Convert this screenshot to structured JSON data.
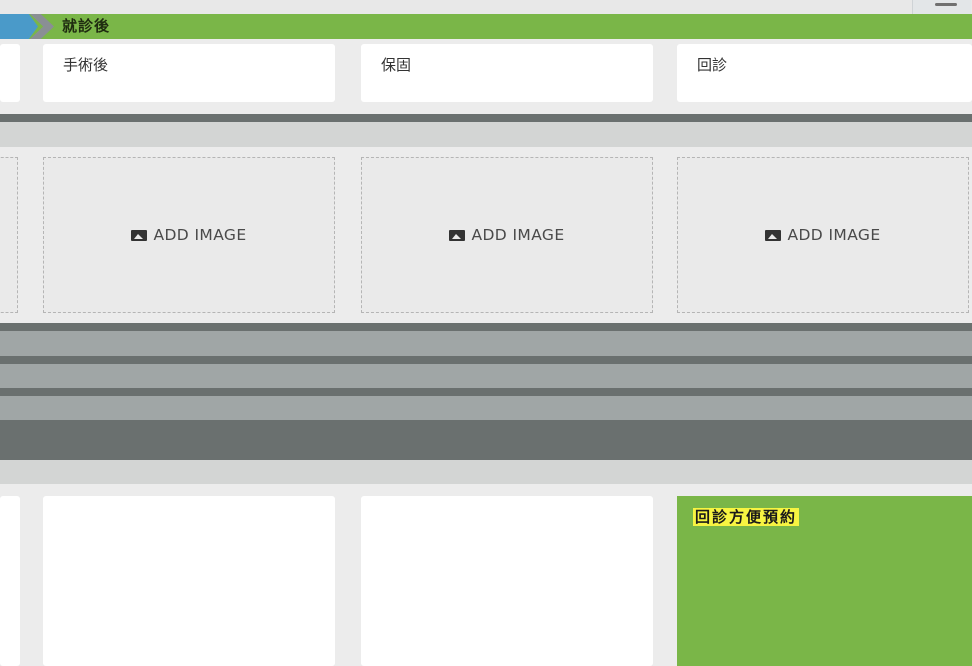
{
  "header": {
    "section_title": "就診後"
  },
  "cards_top": [
    {
      "label": "手術後"
    },
    {
      "label": "保固"
    },
    {
      "label": "回診"
    }
  ],
  "image_slots": [
    {
      "label": "ADD IMAGE"
    },
    {
      "label": "ADD IMAGE"
    },
    {
      "label": "ADD IMAGE"
    }
  ],
  "cards_bottom": [
    {
      "label": ""
    },
    {
      "label": ""
    },
    {
      "label": "回診方便預約"
    }
  ],
  "colors": {
    "section_green": "#7ab648",
    "highlight_yellow": "#f7f442",
    "arrow_blue": "#4a9ac9",
    "band_dark": "#6a706f",
    "band_mid": "#a0a6a6",
    "band_light": "#d3d5d4"
  },
  "icons": [
    "image-icon"
  ]
}
